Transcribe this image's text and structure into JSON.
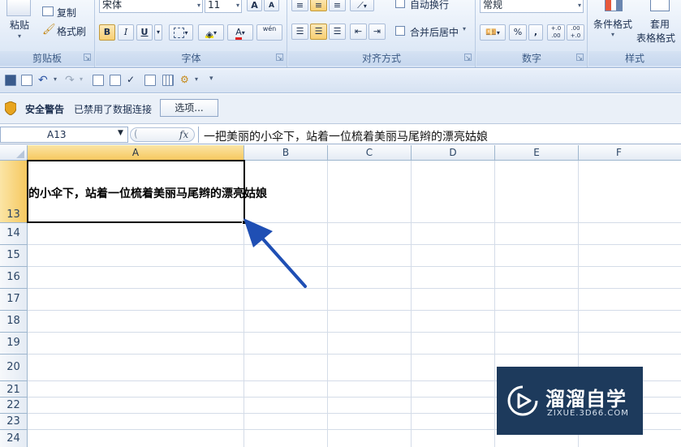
{
  "ribbon": {
    "clipboard": {
      "paste": "粘贴",
      "copy": "复制",
      "format_painter": "格式刷",
      "label": "剪贴板"
    },
    "font": {
      "name": "宋体",
      "size": "11",
      "grow": "A",
      "shrink": "A",
      "bold": "B",
      "italic": "I",
      "underline": "U",
      "font_color": "A",
      "phonetic": "wén",
      "label": "字体"
    },
    "alignment": {
      "wrap_text": "自动换行",
      "merge_center": "合并后居中",
      "label": "对齐方式"
    },
    "number": {
      "format": "常规",
      "percent": "%",
      "comma": ",",
      "inc_decimal": "+.0 .00",
      "dec_decimal": ".00 +.0",
      "label": "数字"
    },
    "styles": {
      "conditional": "条件格式",
      "table_format": "套用",
      "table_format2": "表格格式",
      "label": "样式"
    }
  },
  "security_bar": {
    "title": "安全警告",
    "message": "已禁用了数据连接",
    "options_button": "选项..."
  },
  "formula_bar": {
    "cell_ref": "A13",
    "fx": "fx",
    "content": "一把美丽的小伞下，站着一位梳着美丽马尾辫的漂亮姑娘"
  },
  "grid": {
    "columns": [
      "A",
      "B",
      "C",
      "D",
      "E",
      "F"
    ],
    "rows": [
      "13",
      "14",
      "15",
      "16",
      "17",
      "18",
      "19",
      "20",
      "21",
      "22",
      "23",
      "24"
    ],
    "active_cell_text": "的小伞下，站着一位梳着美丽马尾辫的漂亮姑娘"
  },
  "watermark": {
    "title": "溜溜自学",
    "url": "ZIXUE.3D66.COM"
  },
  "colors": {
    "ribbon_bg": "#dce7f5",
    "selection_header": "#f6c85f",
    "arrow": "#1f4fb4",
    "watermark_bg": "#1d3a5c"
  }
}
